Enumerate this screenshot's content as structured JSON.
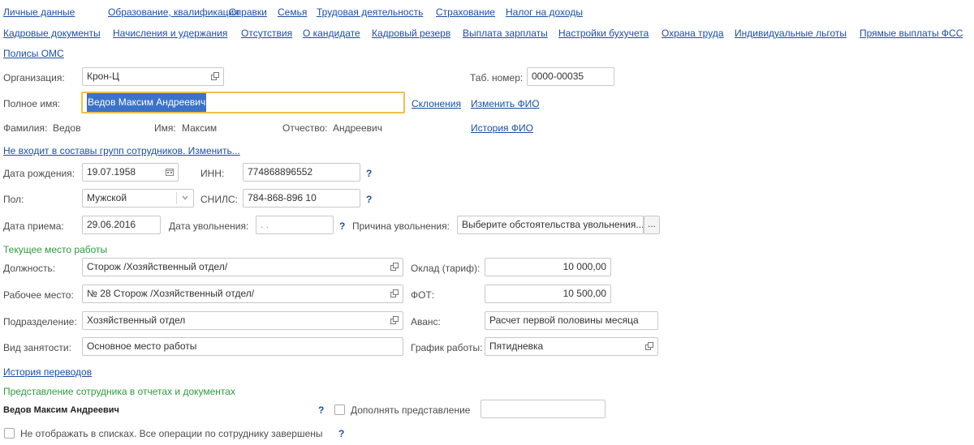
{
  "nav": {
    "row1": [
      "Личные данные",
      "Образование, квалификация",
      "Справки",
      "Семья",
      "Трудовая деятельность",
      "Страхование",
      "Налог на доходы"
    ],
    "row2": [
      "Кадровые документы",
      "Начисления и удержания",
      "Отсутствия",
      "О кандидате",
      "Кадровый резерв",
      "Выплата зарплаты",
      "Настройки бухучета",
      "Охрана труда",
      "Индивидуальные льготы",
      "Прямые выплаты ФСС"
    ],
    "row3": [
      "Полисы ОМС"
    ]
  },
  "form": {
    "org_label": "Организация:",
    "org_value": "Крон-Ц",
    "tab_label": "Таб. номер:",
    "tab_value": "0000-00035",
    "fullname_label": "Полное имя:",
    "fullname_value": "Ведов Максим Андреевич",
    "declension_link": "Склонения",
    "change_fio_link": "Изменить ФИО",
    "surname_label": "Фамилия:",
    "surname_value": "Ведов",
    "name_label": "Имя:",
    "name_value": "Максим",
    "patronymic_label": "Отчество:",
    "patronymic_value": "Андреевич",
    "fio_history_link": "История ФИО",
    "groups_link": "Не входит в составы групп сотрудников. Изменить...",
    "birth_label": "Дата рождения:",
    "birth_value": "19.07.1958",
    "inn_label": "ИНН:",
    "inn_value": "774868896552",
    "gender_label": "Пол:",
    "gender_value": "Мужской",
    "snils_label": "СНИЛС:",
    "snils_value": "784-868-896 10",
    "hire_label": "Дата приема:",
    "hire_value": "29.06.2016",
    "dismiss_label": "Дата увольнения:",
    "dismiss_value": " .  .",
    "reason_label": "Причина увольнения:",
    "reason_value": "Выберите обстоятельства увольнения...",
    "reason_btn": "...",
    "question": "?"
  },
  "work": {
    "section_title": "Текущее место работы",
    "position_label": "Должность:",
    "position_value": "Сторож /Хозяйственный отдел/",
    "salary_label": "Оклад (тариф):",
    "salary_value": "10 000,00",
    "workplace_label": "Рабочее место:",
    "workplace_value": "№ 28 Сторож /Хозяйственный отдел/",
    "fot_label": "ФОТ:",
    "fot_value": "10 500,00",
    "dept_label": "Подразделение:",
    "dept_value": "Хозяйственный отдел",
    "advance_label": "Аванс:",
    "advance_value": "Расчет первой половины месяца",
    "employment_label": "Вид занятости:",
    "employment_value": "Основное место работы",
    "schedule_label": "График работы:",
    "schedule_value": "Пятидневка",
    "transfers_link": "История переводов"
  },
  "representation": {
    "section_title": "Представление сотрудника в отчетах и документах",
    "name": "Ведов Максим Андреевич",
    "supplement_label": "Дополнять представление",
    "supplement_value": "",
    "hide_label": "Не отображать в списках. Все операции по сотруднику завершены"
  },
  "icons": {
    "open": "open-form-icon",
    "calendar": "calendar-icon",
    "dropdown": "dropdown-arrow-icon",
    "help": "help-question-icon"
  },
  "colors": {
    "link": "#1a4fa8",
    "section": "#2e9a3e",
    "focus_border": "#f0c04a",
    "selection": "#3a73c9"
  }
}
